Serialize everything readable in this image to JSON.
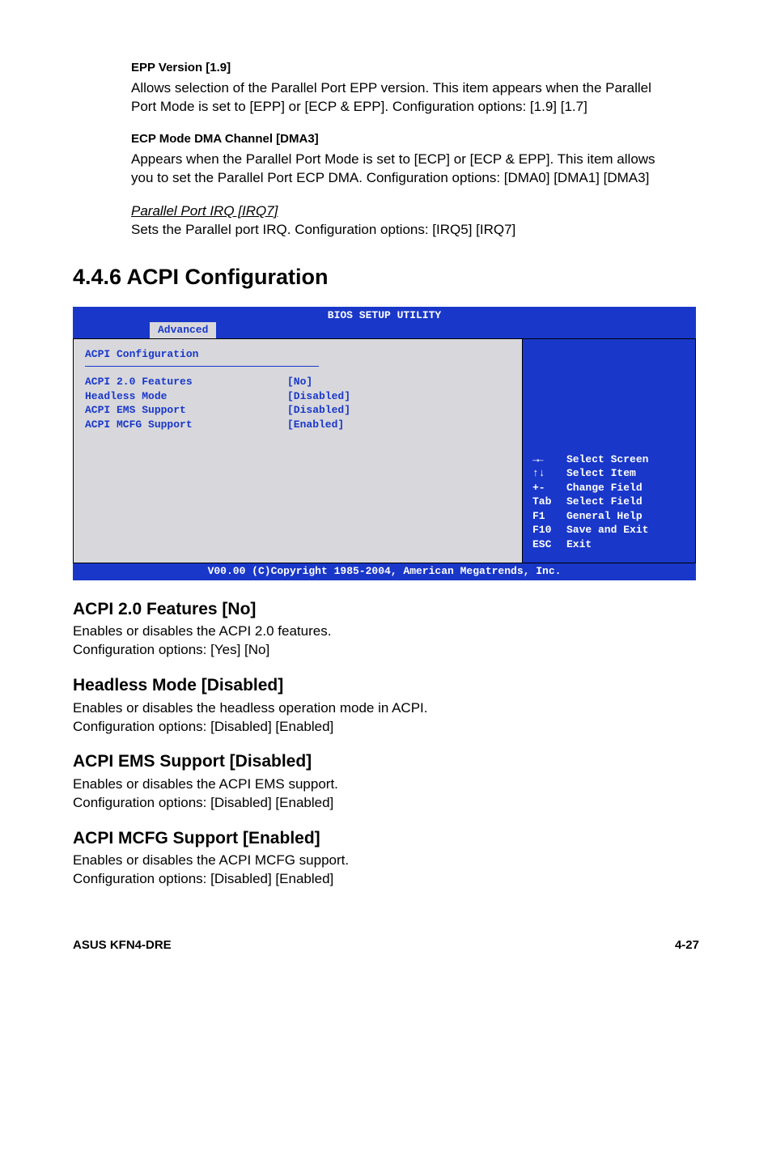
{
  "epp": {
    "heading": "EPP Version [1.9]",
    "body": "Allows selection of the Parallel Port EPP version. This item appears when the Parallel Port Mode is set to [EPP] or [ECP & EPP]. Configuration options: [1.9] [1.7]"
  },
  "ecp": {
    "heading": "ECP Mode DMA Channel [DMA3]",
    "body": "Appears when the Parallel Port Mode is set to [ECP] or [ECP & EPP]. This item allows you to set the Parallel Port ECP DMA. Configuration options: [DMA0] [DMA1] [DMA3]"
  },
  "ppirq": {
    "heading": "Parallel Port IRQ [IRQ7]",
    "body": "Sets the Parallel port IRQ. Configuration options: [IRQ5] [IRQ7]"
  },
  "section": {
    "num_title": "4.4.6   ACPI Configuration"
  },
  "bios": {
    "title": "BIOS SETUP UTILITY",
    "tab": "Advanced",
    "panel_title": "ACPI Configuration",
    "rows": [
      {
        "label": "ACPI 2.0 Features",
        "value": "[No]"
      },
      {
        "label": "Headless Mode",
        "value": "[Disabled]"
      },
      {
        "label": "ACPI EMS Support",
        "value": "[Disabled]"
      },
      {
        "label": "ACPI MCFG Support",
        "value": "[Enabled]"
      }
    ],
    "help": [
      {
        "key": "→←",
        "txt": "Select Screen"
      },
      {
        "key": "↑↓",
        "txt": "Select Item"
      },
      {
        "key": "+-",
        "txt": "Change Field"
      },
      {
        "key": "Tab",
        "txt": "Select Field"
      },
      {
        "key": "F1",
        "txt": "General Help"
      },
      {
        "key": "F10",
        "txt": "Save and Exit"
      },
      {
        "key": "ESC",
        "txt": "Exit"
      }
    ],
    "footer": "V00.00 (C)Copyright 1985-2004, American Megatrends, Inc."
  },
  "acpi20": {
    "heading": "ACPI 2.0 Features [No]",
    "l1": "Enables or disables the ACPI 2.0 features.",
    "l2": "Configuration options: [Yes] [No]"
  },
  "headless": {
    "heading": "Headless Mode [Disabled]",
    "l1": "Enables or disables the headless operation mode in ACPI.",
    "l2": "Configuration options: [Disabled] [Enabled]"
  },
  "ems": {
    "heading": "ACPI EMS Support [Disabled]",
    "l1": "Enables or disables the ACPI EMS support.",
    "l2": "Configuration options: [Disabled] [Enabled]"
  },
  "mcfg": {
    "heading": "ACPI MCFG Support [Enabled]",
    "l1": "Enables or disables the ACPI MCFG support.",
    "l2": "Configuration options: [Disabled] [Enabled]"
  },
  "footer": {
    "left": "ASUS KFN4-DRE",
    "right": "4-27"
  }
}
